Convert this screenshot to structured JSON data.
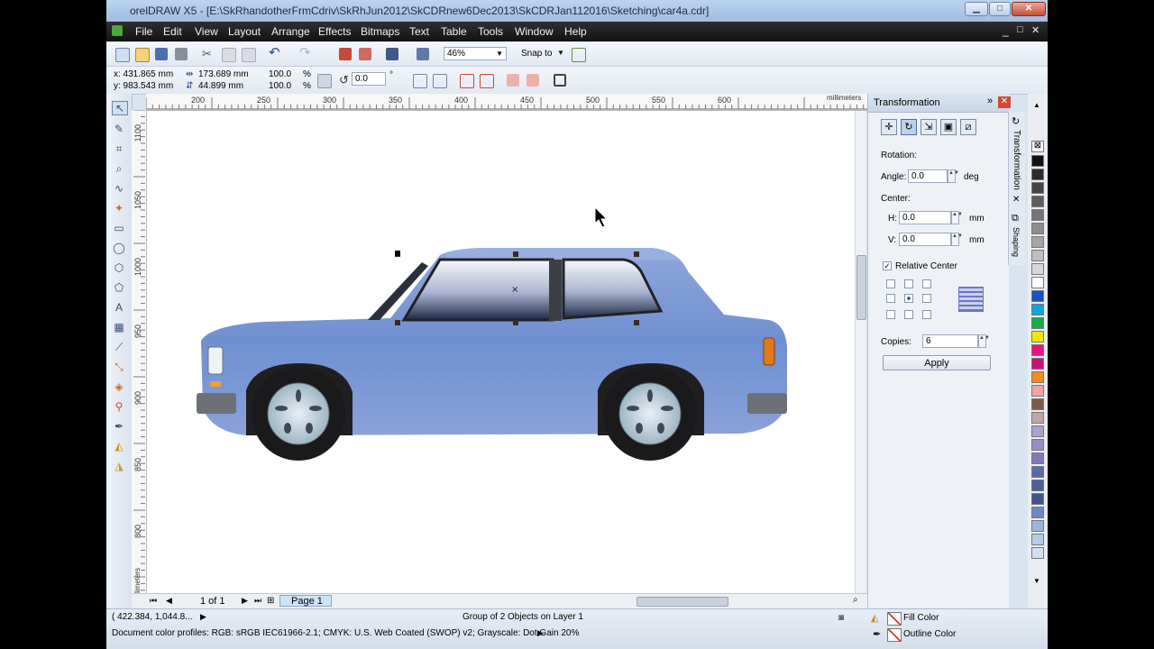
{
  "window": {
    "title": "orelDRAW X5 - [E:\\SkRhandotherFrmCdriv\\SkRhJun2012\\SkCDRnew6Dec2013\\SkCDRJan112016\\Sketching\\car4a.cdr]",
    "minimize": "▁",
    "maximize": "□",
    "close": "✕"
  },
  "menu": {
    "items": [
      "File",
      "Edit",
      "View",
      "Layout",
      "Arrange",
      "Effects",
      "Bitmaps",
      "Text",
      "Table",
      "Tools",
      "Window",
      "Help"
    ],
    "doc_controls": [
      "_",
      "□",
      "✕"
    ]
  },
  "toolbar": {
    "zoom": "46%",
    "snap_to": "Snap to"
  },
  "property_bar": {
    "x": "x: 431.865 mm",
    "y": "y: 983.543 mm",
    "width": "173.689 mm",
    "height": "44.899 mm",
    "scale_w": "100.0",
    "scale_h": "100.0",
    "pct": "%",
    "rotation": "0.0",
    "degree": "°"
  },
  "rulers": {
    "unit": "millimeters",
    "h_ticks": [
      "200",
      "250",
      "300",
      "350",
      "400",
      "450",
      "500",
      "550",
      "600"
    ],
    "v_ticks": [
      "1100",
      "1050",
      "1000",
      "950",
      "900",
      "850",
      "800",
      "millimeters"
    ]
  },
  "page_nav": {
    "counter": "1 of 1",
    "page_tab": "Page 1"
  },
  "status": {
    "coords": "( 422.384, 1,044.8...",
    "selection": "Group of 2 Objects on Layer 1",
    "profiles": "Document color profiles: RGB: sRGB IEC61966-2.1; CMYK: U.S. Web Coated (SWOP) v2; Grayscale: Dot Gain 20%",
    "fill_label": "Fill Color",
    "outline_label": "Outline Color"
  },
  "docker": {
    "title": "Transformation",
    "rotation_label": "Rotation:",
    "angle_label": "Angle:",
    "angle_value": "0.0",
    "angle_unit": "deg",
    "center_label": "Center:",
    "h_label": "H:",
    "h_value": "0.0",
    "v_label": "V:",
    "v_value": "0.0",
    "unit": "mm",
    "relative_center": "Relative Center",
    "copies_label": "Copies:",
    "copies_value": "6",
    "apply": "Apply",
    "side_tabs": [
      "Transformation",
      "Shaping"
    ]
  },
  "palette_colors": [
    "#111111",
    "#2b2b2b",
    "#444444",
    "#5c5c5c",
    "#747474",
    "#8d8d8d",
    "#a6a6a6",
    "#bfbfbf",
    "#d8d8d8",
    "#ffffff",
    "#1a52c6",
    "#12a3e0",
    "#19a84a",
    "#f5e600",
    "#e8137c",
    "#c7137a",
    "#f78c1e",
    "#f2a3a3",
    "#7a5c46",
    "#bfa6a6",
    "#a7a2d1",
    "#9a8bc6",
    "#8377b8",
    "#5a6aa8",
    "#4c5e9a",
    "#3f558f",
    "#6f86c2",
    "#9bb5de",
    "#b4cbe8",
    "#cfe0f2"
  ]
}
